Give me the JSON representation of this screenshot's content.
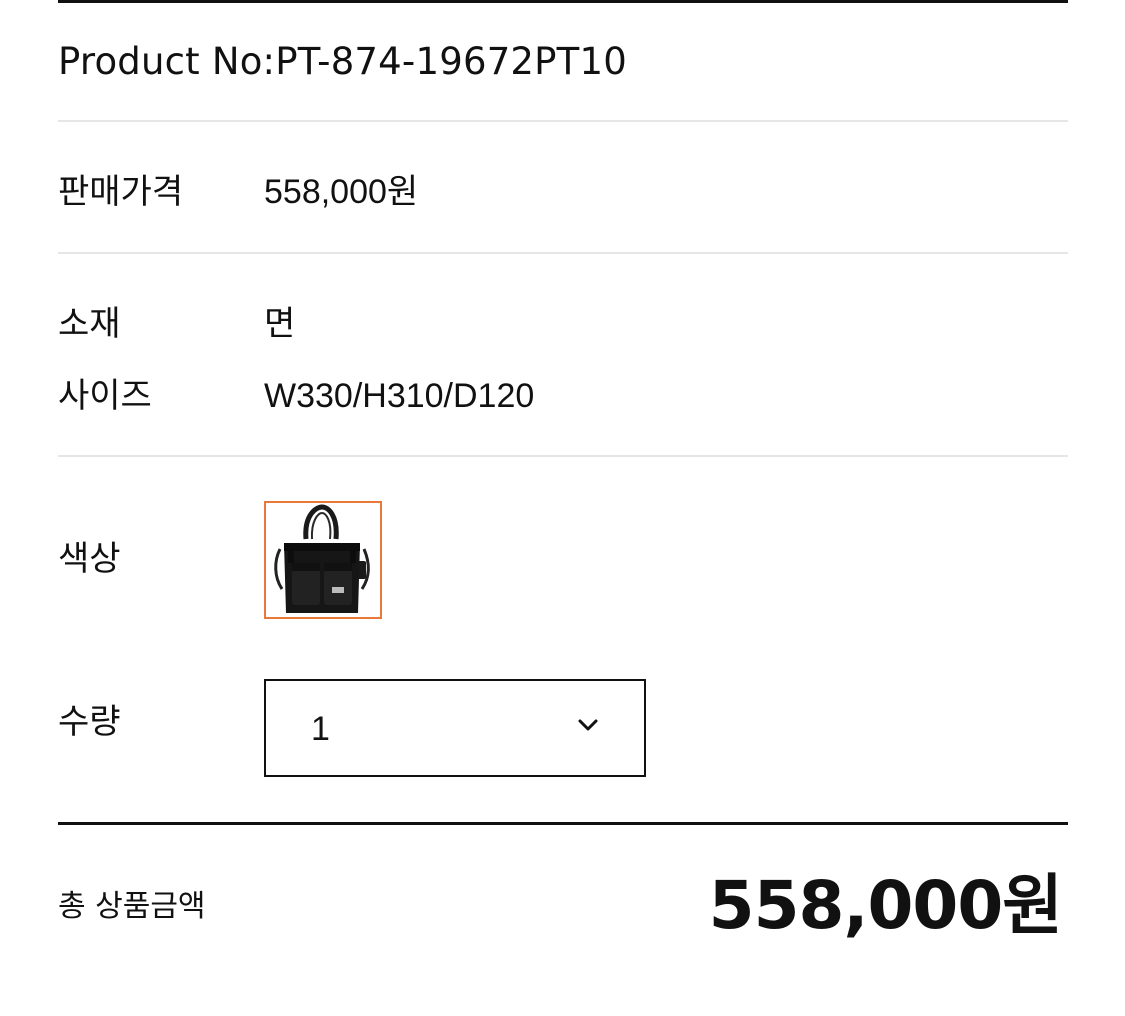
{
  "product": {
    "product_no": "Product No:PT-874-19672PT10"
  },
  "price": {
    "label": "판매가격",
    "value": "558,000원"
  },
  "material": {
    "label": "소재",
    "value": "면"
  },
  "size": {
    "label": "사이즈",
    "value": "W330/H310/D120"
  },
  "color": {
    "label": "색상",
    "swatch_icon": "black-tote-bag-thumbnail",
    "selected_border_color": "#e8793a"
  },
  "quantity": {
    "label": "수량",
    "selected": "1",
    "icon": "chevron-down-icon"
  },
  "total": {
    "label": "총 상품금액",
    "amount": "558,000원"
  }
}
